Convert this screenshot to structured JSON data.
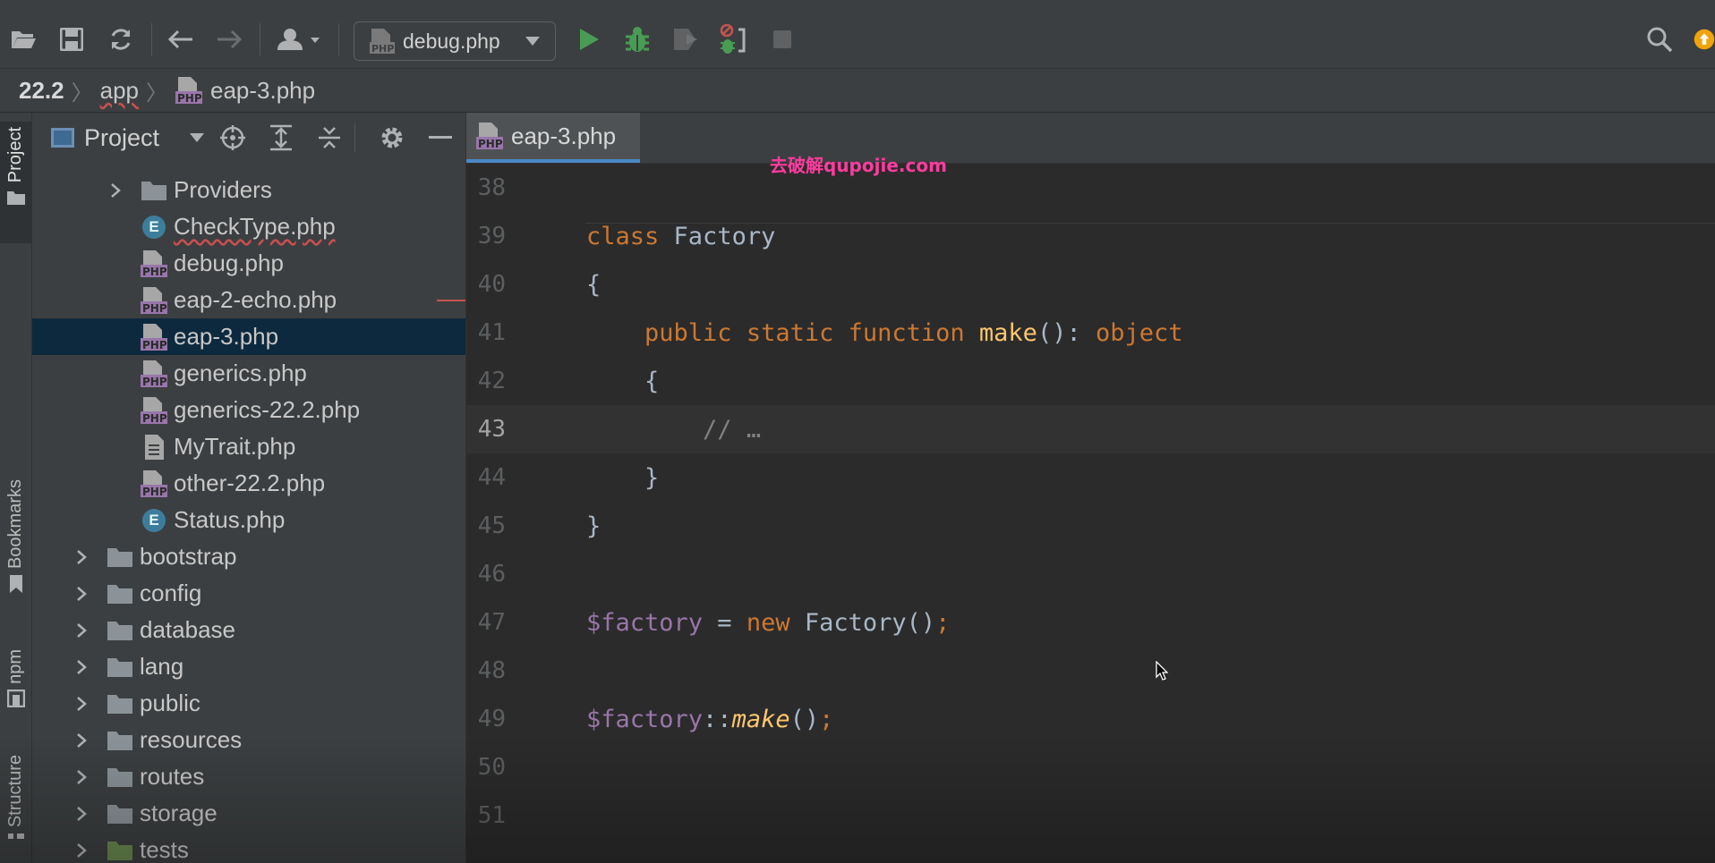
{
  "toolbar": {
    "run_config": "debug.php",
    "icons": [
      "open-folder-icon",
      "save-icon",
      "sync-icon",
      "back-icon",
      "forward-icon",
      "user-icon",
      "php-file-icon",
      "run-icon",
      "debug-icon",
      "coverage-icon",
      "listen-debug-icon",
      "stop-icon",
      "search-icon",
      "update-icon"
    ],
    "colors": {
      "run": "#499c54",
      "debug": "#499c54",
      "update": "#f0a30a"
    }
  },
  "breadcrumb": {
    "items": [
      "22.2",
      "app",
      "eap-3.php"
    ]
  },
  "left_stripe": {
    "tabs": [
      "Project",
      "Bookmarks",
      "npm",
      "Structure"
    ]
  },
  "project_panel": {
    "title": "Project",
    "tree": [
      {
        "name": "Providers",
        "type": "folder",
        "expanded": false,
        "level": 2
      },
      {
        "name": "CheckType.php",
        "type": "enum",
        "level": 2,
        "error": true
      },
      {
        "name": "debug.php",
        "type": "php",
        "level": 2
      },
      {
        "name": "eap-2-echo.php",
        "type": "php",
        "level": 2
      },
      {
        "name": "eap-3.php",
        "type": "php",
        "level": 2,
        "selected": true
      },
      {
        "name": "generics.php",
        "type": "php",
        "level": 2
      },
      {
        "name": "generics-22.2.php",
        "type": "php",
        "level": 2
      },
      {
        "name": "MyTrait.php",
        "type": "file",
        "level": 2
      },
      {
        "name": "other-22.2.php",
        "type": "php",
        "level": 2
      },
      {
        "name": "Status.php",
        "type": "enum",
        "level": 2
      },
      {
        "name": "bootstrap",
        "type": "folder",
        "level": 1
      },
      {
        "name": "config",
        "type": "folder",
        "level": 1
      },
      {
        "name": "database",
        "type": "folder",
        "level": 1
      },
      {
        "name": "lang",
        "type": "folder",
        "level": 1
      },
      {
        "name": "public",
        "type": "folder",
        "level": 1
      },
      {
        "name": "resources",
        "type": "folder",
        "level": 1
      },
      {
        "name": "routes",
        "type": "folder",
        "level": 1
      },
      {
        "name": "storage",
        "type": "folder",
        "level": 1
      },
      {
        "name": "tests",
        "type": "folder",
        "level": 1
      }
    ]
  },
  "editor": {
    "tab": "eap-3.php",
    "watermark": "去破解qupojie.com",
    "current_line": 43,
    "lines": [
      {
        "n": "38",
        "tokens": []
      },
      {
        "n": "39",
        "tokens": [
          {
            "t": "class ",
            "c": "kw"
          },
          {
            "t": "Factory",
            "c": "pl"
          }
        ]
      },
      {
        "n": "40",
        "tokens": [
          {
            "t": "{",
            "c": "pl"
          }
        ]
      },
      {
        "n": "41",
        "tokens": [
          {
            "t": "    ",
            "c": "pl"
          },
          {
            "t": "public static function ",
            "c": "kw"
          },
          {
            "t": "make",
            "c": "fn"
          },
          {
            "t": "(): ",
            "c": "pl"
          },
          {
            "t": "object",
            "c": "kw"
          }
        ]
      },
      {
        "n": "42",
        "tokens": [
          {
            "t": "    {",
            "c": "pl"
          }
        ]
      },
      {
        "n": "43",
        "tokens": [
          {
            "t": "        ",
            "c": "pl"
          },
          {
            "t": "// …",
            "c": "cm"
          }
        ]
      },
      {
        "n": "44",
        "tokens": [
          {
            "t": "    }",
            "c": "pl"
          }
        ]
      },
      {
        "n": "45",
        "tokens": [
          {
            "t": "}",
            "c": "pl"
          }
        ]
      },
      {
        "n": "46",
        "tokens": []
      },
      {
        "n": "47",
        "tokens": [
          {
            "t": "$factory",
            "c": "var"
          },
          {
            "t": " = ",
            "c": "pl"
          },
          {
            "t": "new ",
            "c": "kw"
          },
          {
            "t": "Factory()",
            "c": "pl"
          },
          {
            "t": ";",
            "c": "kw"
          }
        ]
      },
      {
        "n": "48",
        "tokens": []
      },
      {
        "n": "49",
        "tokens": [
          {
            "t": "$factory",
            "c": "var"
          },
          {
            "t": "::",
            "c": "pl"
          },
          {
            "t": "make",
            "c": "fni"
          },
          {
            "t": "()",
            "c": "pl"
          },
          {
            "t": ";",
            "c": "kw"
          }
        ]
      },
      {
        "n": "50",
        "tokens": []
      },
      {
        "n": "51",
        "tokens": []
      }
    ]
  }
}
